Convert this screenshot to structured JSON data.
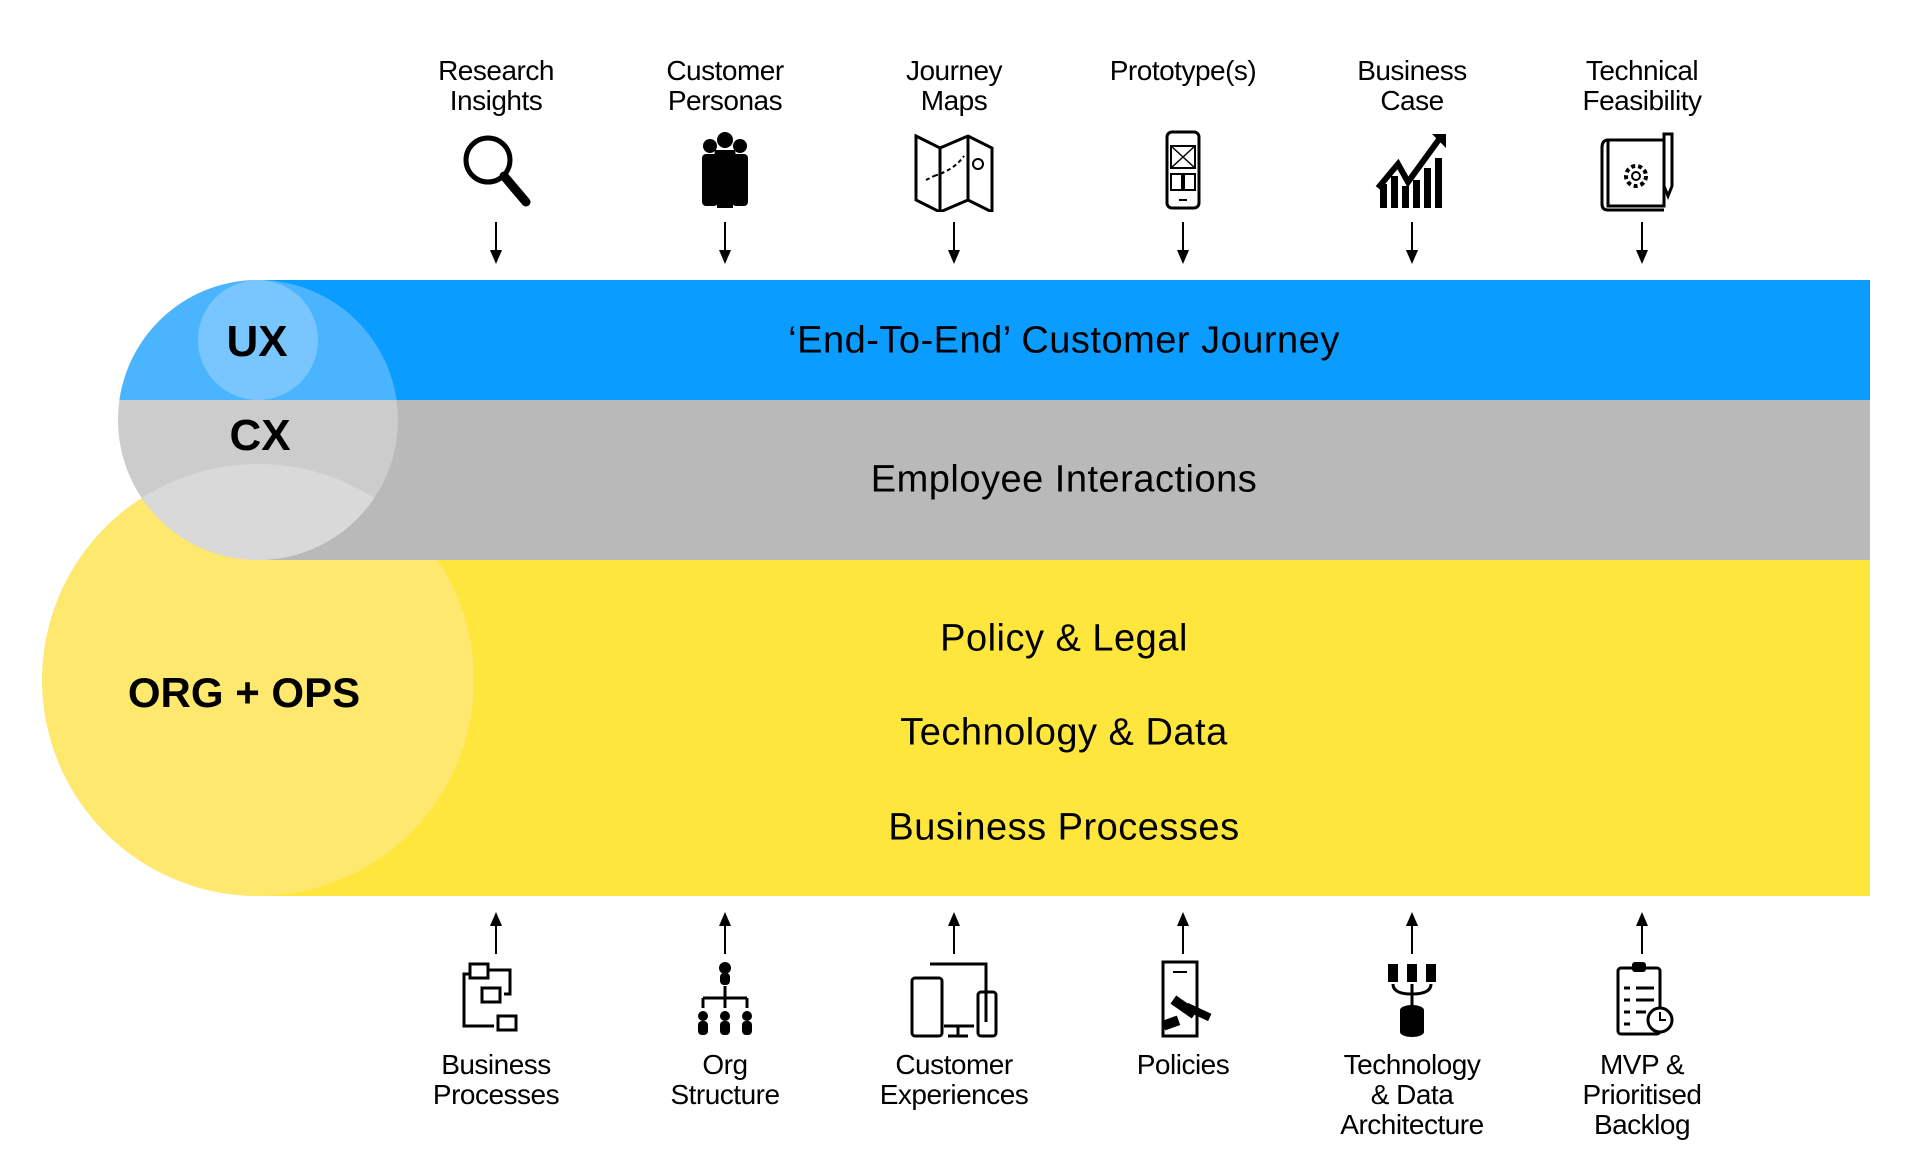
{
  "colors": {
    "ux_band": "#0a9dff",
    "cx_band": "#b9b9b9",
    "ops_band": "#ffe63c",
    "ux_circle": "#79c6ff",
    "cx_circle": "#cccccc",
    "ops_circle": "#ffe86e"
  },
  "circles": {
    "ux": "UX",
    "cx": "CX",
    "ops": "ORG + OPS"
  },
  "bands": {
    "ux": "‘End-To-End’ Customer Journey",
    "cx": "Employee Interactions",
    "ops": [
      "Policy & Legal",
      "Technology & Data",
      "Business Processes"
    ]
  },
  "inputs": [
    {
      "label": [
        "Research",
        "Insights"
      ],
      "icon": "magnifier-icon"
    },
    {
      "label": [
        "Customer",
        "Personas"
      ],
      "icon": "people-icon"
    },
    {
      "label": [
        "Journey",
        "Maps"
      ],
      "icon": "map-icon"
    },
    {
      "label": [
        "Prototype(s)"
      ],
      "icon": "phone-wireframe-icon"
    },
    {
      "label": [
        "Business",
        "Case"
      ],
      "icon": "growth-chart-icon"
    },
    {
      "label": [
        "Technical",
        "Feasibility"
      ],
      "icon": "blueprint-icon"
    }
  ],
  "outputs": [
    {
      "label": [
        "Business",
        "Processes"
      ],
      "icon": "flowchart-icon"
    },
    {
      "label": [
        "Org",
        "Structure"
      ],
      "icon": "org-chart-icon"
    },
    {
      "label": [
        "Customer",
        "Experiences"
      ],
      "icon": "devices-icon"
    },
    {
      "label": [
        "Policies"
      ],
      "icon": "gavel-document-icon"
    },
    {
      "label": [
        "Technology",
        "& Data",
        "Architecture"
      ],
      "icon": "database-servers-icon"
    },
    {
      "label": [
        "MVP &",
        "Prioritised",
        "Backlog"
      ],
      "icon": "clipboard-checklist-icon"
    }
  ]
}
